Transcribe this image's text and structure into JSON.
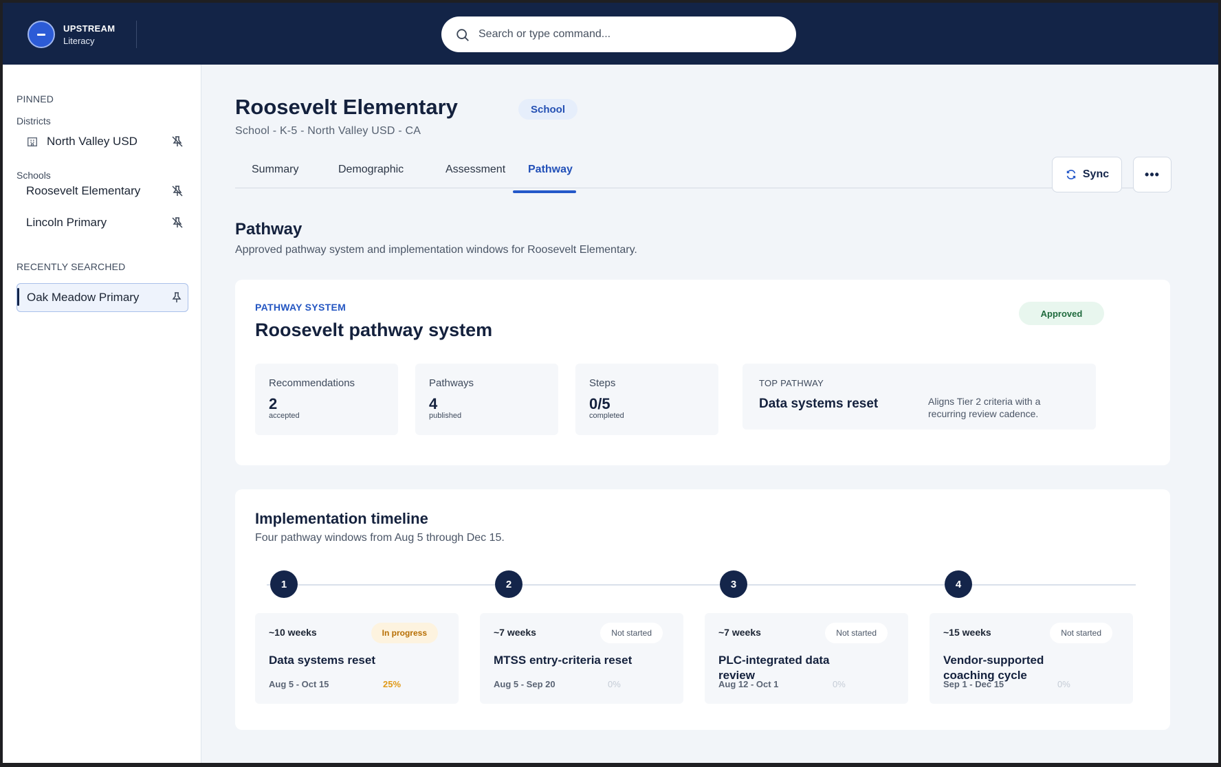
{
  "app": {
    "brand_name": "UPSTREAM",
    "brand_sub": "Literacy"
  },
  "search": {
    "placeholder": "Search or type command..."
  },
  "sidebar": {
    "pinned_heading": "PINNED",
    "districts_heading": "Districts",
    "districts": [
      {
        "label": "North Valley USD"
      }
    ],
    "schools_heading": "Schools",
    "schools": [
      {
        "label": "Roosevelt Elementary"
      },
      {
        "label": "Lincoln Primary"
      }
    ],
    "recent_heading": "RECENTLY SEARCHED",
    "recent": [
      {
        "label": "Oak Meadow Primary"
      }
    ]
  },
  "header": {
    "title": "Roosevelt Elementary",
    "chip": "School",
    "subtitle": "School - K-5 - North Valley USD - CA"
  },
  "tabs": [
    {
      "label": "Summary"
    },
    {
      "label": "Demographic"
    },
    {
      "label": "Assessment"
    },
    {
      "label": "Pathway",
      "active": true
    }
  ],
  "actions": {
    "sync_label": "Sync",
    "more_label": "•••"
  },
  "section": {
    "title": "Pathway",
    "description": "Approved pathway system and implementation windows for Roosevelt Elementary."
  },
  "pathway_system": {
    "eyebrow": "PATHWAY SYSTEM",
    "title": "Roosevelt pathway system",
    "status": "Approved",
    "stats": [
      {
        "label": "Recommendations",
        "value": "2",
        "unit": "accepted"
      },
      {
        "label": "Pathways",
        "value": "4",
        "unit": "published"
      },
      {
        "label": "Steps",
        "value": "0/5",
        "unit": "completed"
      }
    ],
    "top_pathway": {
      "eyebrow": "TOP PATHWAY",
      "name": "Data systems reset",
      "description": "Aligns Tier 2 criteria with a recurring review cadence."
    }
  },
  "timeline": {
    "title": "Implementation timeline",
    "description": "Four pathway windows from Aug 5 through Dec 15.",
    "steps": [
      {
        "number": "1",
        "weeks": "~10 weeks",
        "status": "In progress",
        "name": "Data systems reset",
        "dates": "Aug 5 - Oct 15",
        "percent": "25%"
      },
      {
        "number": "2",
        "weeks": "~7 weeks",
        "status": "Not started",
        "name": "MTSS entry-criteria reset",
        "dates": "Aug 5 - Sep 20",
        "percent": "0%"
      },
      {
        "number": "3",
        "weeks": "~7 weeks",
        "status": "Not started",
        "name": "PLC-integrated data review",
        "dates": "Aug 12 - Oct 1",
        "percent": "0%"
      },
      {
        "number": "4",
        "weeks": "~15 weeks",
        "status": "Not started",
        "name": "Vendor-supported coaching cycle",
        "dates": "Sep 1 - Dec 15",
        "percent": "0%"
      }
    ]
  },
  "colors": {
    "navy": "#132447",
    "accent": "#2458c9",
    "approved": "#1f6a3d",
    "in_progress": "#e09a18"
  }
}
